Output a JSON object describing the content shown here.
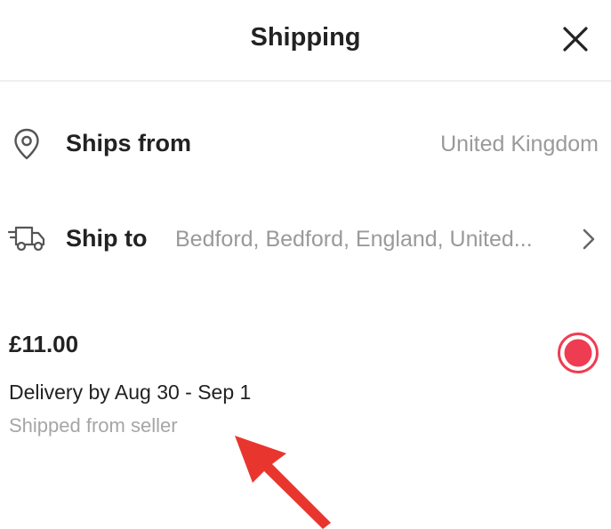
{
  "header": {
    "title": "Shipping",
    "close_icon": "close-icon"
  },
  "ships_from": {
    "icon": "location-pin-icon",
    "label": "Ships from",
    "value": "United Kingdom"
  },
  "ship_to": {
    "icon": "delivery-truck-icon",
    "label": "Ship to",
    "value": "Bedford, Bedford, England, United...",
    "chevron_icon": "chevron-right-icon"
  },
  "shipping_option": {
    "price": "£11.00",
    "delivery": "Delivery by Aug 30 - Sep 1",
    "origin": "Shipped from seller",
    "selected": true,
    "accent_color": "#ee3d52"
  },
  "annotation": {
    "icon": "red-arrow-icon",
    "color": "#e8362e"
  }
}
